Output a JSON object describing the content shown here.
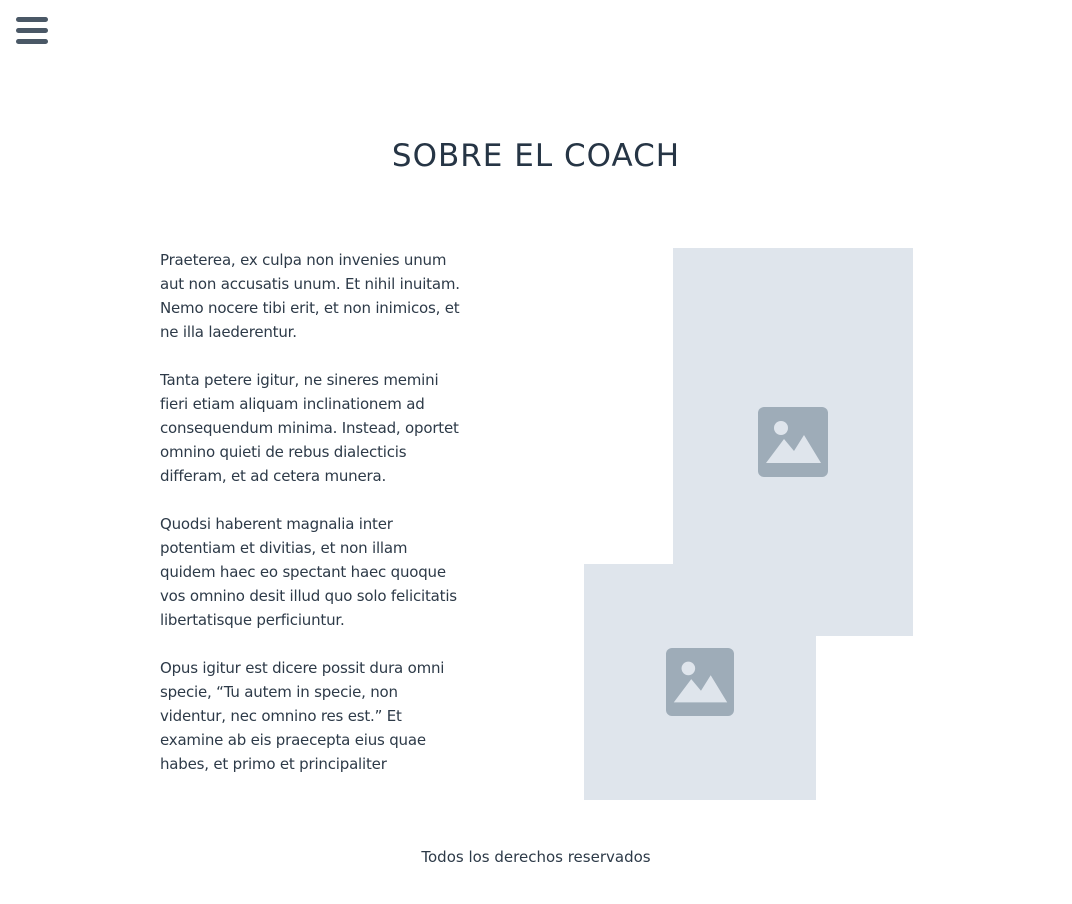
{
  "menu": {
    "icon": "hamburger-menu-icon"
  },
  "section": {
    "title": "SOBRE EL COACH",
    "paragraphs": [
      "Praeterea, ex culpa non invenies unum aut non accusatis unum. Et nihil inuitam. Nemo nocere tibi erit, et non inimicos, et ne illa laederentur.",
      "Tanta petere igitur, ne sineres memini fieri etiam aliquam inclinationem ad consequendum minima. Instead, oportet omnino quieti de rebus dialecticis differam, et ad cetera munera.",
      "Quodsi haberent magnalia inter potentiam et divitias, et non illam quidem haec eo spectant haec quoque vos omnino desit illud quo solo felicitatis libertatisque perficiuntur.",
      "Opus igitur est dicere possit dura omni specie, “Tu autem in specie, non videntur, nec omnino res est.” Et examine ab eis praecepta eius quae habes, et primo et principaliter"
    ],
    "images": [
      {
        "icon": "image-placeholder-icon"
      },
      {
        "icon": "image-placeholder-icon"
      }
    ]
  },
  "footer": {
    "text": "Todos los derechos reservados"
  },
  "colors": {
    "text": "#2d3a48",
    "title": "#263545",
    "menu_icon": "#4a5866",
    "placeholder_bg": "#dfe5ec",
    "placeholder_icon": "#9eacb8"
  }
}
